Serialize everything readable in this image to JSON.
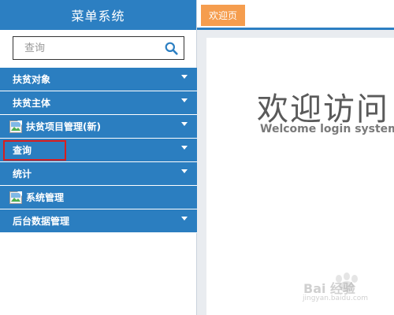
{
  "sidebar": {
    "title": "菜单系统",
    "search": {
      "placeholder": "查询",
      "value": ""
    },
    "items": [
      {
        "label": "扶贫对象",
        "has_image": false
      },
      {
        "label": "扶贫主体",
        "has_image": false
      },
      {
        "label": "扶贫项目管理(新)",
        "has_image": true
      },
      {
        "label": "查询",
        "has_image": false,
        "highlighted": true
      },
      {
        "label": "统计",
        "has_image": false
      },
      {
        "label": "系统管理",
        "has_image": true
      },
      {
        "label": "后台数据管理",
        "has_image": false
      }
    ]
  },
  "tabs": [
    {
      "label": "欢迎页",
      "active": true
    }
  ],
  "welcome": {
    "title": "欢迎访问",
    "subtitle": "Welcome login system"
  },
  "watermark": {
    "text": "Bai 经验",
    "url": "jingyan.baidu.com"
  },
  "colors": {
    "accent": "#2c7fc2",
    "tab": "#f59d4e",
    "highlight": "#d81e1e"
  }
}
